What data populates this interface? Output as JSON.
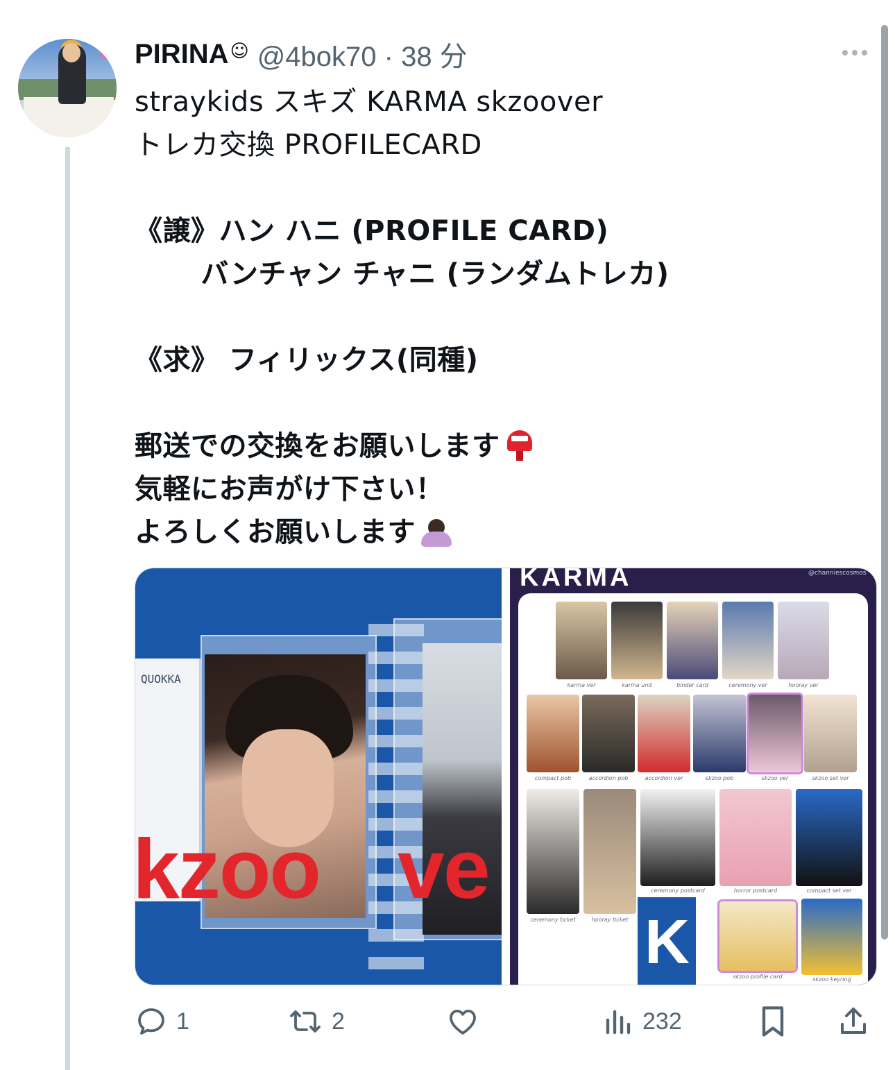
{
  "tweet": {
    "author_name": "PIRINA",
    "author_emoji": "☺",
    "handle_time": "@4bok70 · 38 分",
    "lines": [
      "straykids スキズ KARMA skzoover",
      "トレカ交換 PROFILECARD",
      "",
      "《譲》ハン ハニ (PROFILE CARD)",
      "　　 バンチャン チャニ (ランダムトレカ)",
      "",
      "《求》 フィリックス(同種)",
      "",
      "郵送での交換をお願いします",
      "気軽にお声がけ下さい！",
      "よろしくお願いします"
    ]
  },
  "media": {
    "left": {
      "sleeve_text": "QUOKKA",
      "red_text_1": "kzoo",
      "red_text_2": "ve"
    },
    "right": {
      "credit": "@channiescosmos",
      "labels_row1": [
        "karma ver",
        "karma unit",
        "binder card",
        "ceremony ver",
        "hooray ver"
      ],
      "labels_row2": [
        "compact pob",
        "accordion pob",
        "accordion ver",
        "skzoo pob",
        "skzoo ver",
        "skzoo set ver"
      ],
      "labels_row3": [
        "ceremony ticket",
        "hooray ticket",
        "ceremony postcard",
        "horror postcard",
        "compact set ver"
      ],
      "labels_row4": [
        "skzoo profile card",
        "skzoo keyring"
      ]
    }
  },
  "actions": {
    "reply_count": "1",
    "retweet_count": "2",
    "views_count": "232"
  },
  "icons": {
    "reply": "reply-icon",
    "retweet": "retweet-icon",
    "like": "heart-icon",
    "views": "views-icon",
    "bookmark": "bookmark-icon",
    "share": "share-icon",
    "more": "more-icon"
  },
  "colors": {
    "text": "#0f1419",
    "secondary": "#536471",
    "thread_line": "#cfd9de",
    "accent_red": "#e2262c"
  }
}
